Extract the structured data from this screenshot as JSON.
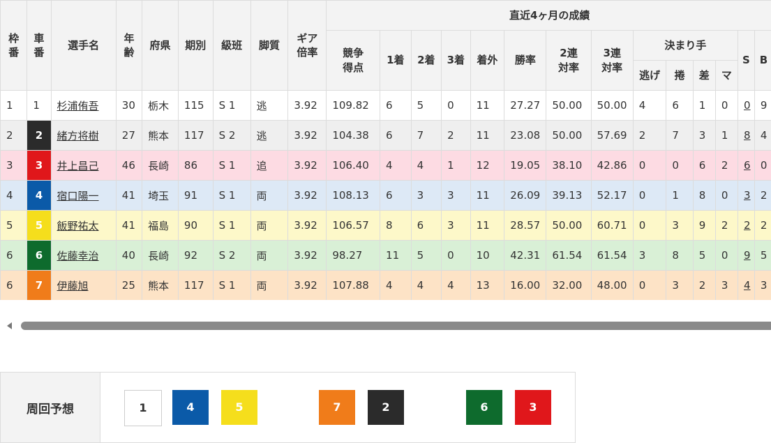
{
  "table": {
    "headers": {
      "waku": "枠番",
      "car": "車番",
      "name": "選手名",
      "age": "年齢",
      "pref": "府県",
      "term": "期別",
      "class": "級班",
      "style": "脚質",
      "gear": "ギア倍率",
      "recent": "直近4ヶ月の成績",
      "score": "競争得点",
      "first": "1着",
      "second": "2着",
      "third": "3着",
      "out": "着外",
      "win_rate": "勝率",
      "rate2": "2連対率",
      "rate3": "3連対率",
      "kimarite": "決まり手",
      "nige": "逃げ",
      "makuri": "捲",
      "sashi": "差",
      "mark": "マ",
      "s": "S",
      "b": "B"
    },
    "rows": [
      {
        "waku": "1",
        "car": "1",
        "name": "杉浦侑吾",
        "age": "30",
        "pref": "栃木",
        "term": "115",
        "class": "S 1",
        "style": "逃",
        "gear": "3.92",
        "score": "109.82",
        "first": "6",
        "second": "5",
        "third": "0",
        "out": "11",
        "win_rate": "27.27",
        "rate2": "50.00",
        "rate3": "50.00",
        "nige": "4",
        "makuri": "6",
        "sashi": "1",
        "mark": "0",
        "s": "0",
        "b": "9"
      },
      {
        "waku": "2",
        "car": "2",
        "name": "緒方将樹",
        "age": "27",
        "pref": "熊本",
        "term": "117",
        "class": "S 2",
        "style": "逃",
        "gear": "3.92",
        "score": "104.38",
        "first": "6",
        "second": "7",
        "third": "2",
        "out": "11",
        "win_rate": "23.08",
        "rate2": "50.00",
        "rate3": "57.69",
        "nige": "2",
        "makuri": "7",
        "sashi": "3",
        "mark": "1",
        "s": "8",
        "b": "4"
      },
      {
        "waku": "3",
        "car": "3",
        "name": "井上昌己",
        "age": "46",
        "pref": "長崎",
        "term": "86",
        "class": "S 1",
        "style": "追",
        "gear": "3.92",
        "score": "106.40",
        "first": "4",
        "second": "4",
        "third": "1",
        "out": "12",
        "win_rate": "19.05",
        "rate2": "38.10",
        "rate3": "42.86",
        "nige": "0",
        "makuri": "0",
        "sashi": "6",
        "mark": "2",
        "s": "6",
        "b": "0"
      },
      {
        "waku": "4",
        "car": "4",
        "name": "宿口陽一",
        "age": "41",
        "pref": "埼玉",
        "term": "91",
        "class": "S 1",
        "style": "両",
        "gear": "3.92",
        "score": "108.13",
        "first": "6",
        "second": "3",
        "third": "3",
        "out": "11",
        "win_rate": "26.09",
        "rate2": "39.13",
        "rate3": "52.17",
        "nige": "0",
        "makuri": "1",
        "sashi": "8",
        "mark": "0",
        "s": "3",
        "b": "2"
      },
      {
        "waku": "5",
        "car": "5",
        "name": "飯野祐太",
        "age": "41",
        "pref": "福島",
        "term": "90",
        "class": "S 1",
        "style": "両",
        "gear": "3.92",
        "score": "106.57",
        "first": "8",
        "second": "6",
        "third": "3",
        "out": "11",
        "win_rate": "28.57",
        "rate2": "50.00",
        "rate3": "60.71",
        "nige": "0",
        "makuri": "3",
        "sashi": "9",
        "mark": "2",
        "s": "2",
        "b": "2"
      },
      {
        "waku": "6",
        "car": "6",
        "name": "佐藤幸治",
        "age": "40",
        "pref": "長崎",
        "term": "92",
        "class": "S 2",
        "style": "両",
        "gear": "3.92",
        "score": "98.27",
        "first": "11",
        "second": "5",
        "third": "0",
        "out": "10",
        "win_rate": "42.31",
        "rate2": "61.54",
        "rate3": "61.54",
        "nige": "3",
        "makuri": "8",
        "sashi": "5",
        "mark": "0",
        "s": "9",
        "b": "5"
      },
      {
        "waku": "6",
        "car": "7",
        "name": "伊藤旭",
        "age": "25",
        "pref": "熊本",
        "term": "117",
        "class": "S 1",
        "style": "両",
        "gear": "3.92",
        "score": "107.88",
        "first": "4",
        "second": "4",
        "third": "4",
        "out": "13",
        "win_rate": "16.00",
        "rate2": "32.00",
        "rate3": "48.00",
        "nige": "0",
        "makuri": "3",
        "sashi": "2",
        "mark": "3",
        "s": "4",
        "b": "3"
      }
    ]
  },
  "car_colors": {
    "1": {
      "bg": "#ffffff",
      "fg": "#333333"
    },
    "2": {
      "bg": "#2b2b2b",
      "fg": "#ffffff"
    },
    "3": {
      "bg": "#e0171b",
      "fg": "#ffffff"
    },
    "4": {
      "bg": "#0b5aa8",
      "fg": "#ffffff"
    },
    "5": {
      "bg": "#f5de1c",
      "fg": "#ffffff"
    },
    "6": {
      "bg": "#0e6b2d",
      "fg": "#ffffff"
    },
    "7": {
      "bg": "#f07c1a",
      "fg": "#ffffff"
    }
  },
  "prediction": {
    "label": "周回予想",
    "chips": [
      {
        "num": "1"
      },
      {
        "num": "4"
      },
      {
        "num": "5"
      },
      {
        "num": "7"
      },
      {
        "num": "2"
      },
      {
        "num": "6"
      },
      {
        "num": "3"
      }
    ]
  }
}
